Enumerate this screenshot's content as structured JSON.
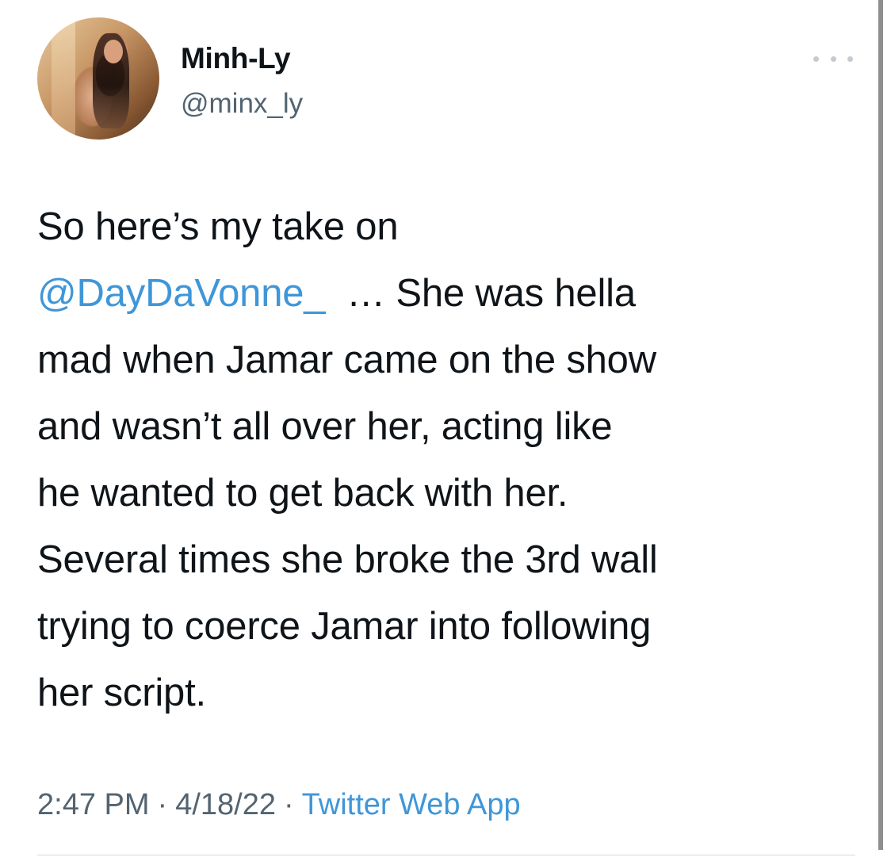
{
  "author": {
    "display_name": "Minh-Ly",
    "handle": "@minx_ly",
    "avatar": "profile-photo"
  },
  "menu": {
    "icon": "more-horizontal-icon"
  },
  "tweet": {
    "lines": [
      {
        "text": "So here’s my take on"
      },
      {
        "mention": "@DayDaVonne_",
        "text": "  … She was hella"
      },
      {
        "text": "mad when Jamar came on the show"
      },
      {
        "text": "and wasn’t all over her, acting like"
      },
      {
        "text": "he wanted to get back with her."
      },
      {
        "text": "Several times she broke the 3rd wall"
      },
      {
        "text": "trying to coerce Jamar into following"
      },
      {
        "text": "her script."
      }
    ]
  },
  "meta": {
    "time": "2:47 PM",
    "separator": "·",
    "date": "4/18/22",
    "source": "Twitter Web App"
  },
  "colors": {
    "text": "#0f1419",
    "secondary": "#536471",
    "link": "#3f96d8",
    "divider": "#cfd9de"
  }
}
